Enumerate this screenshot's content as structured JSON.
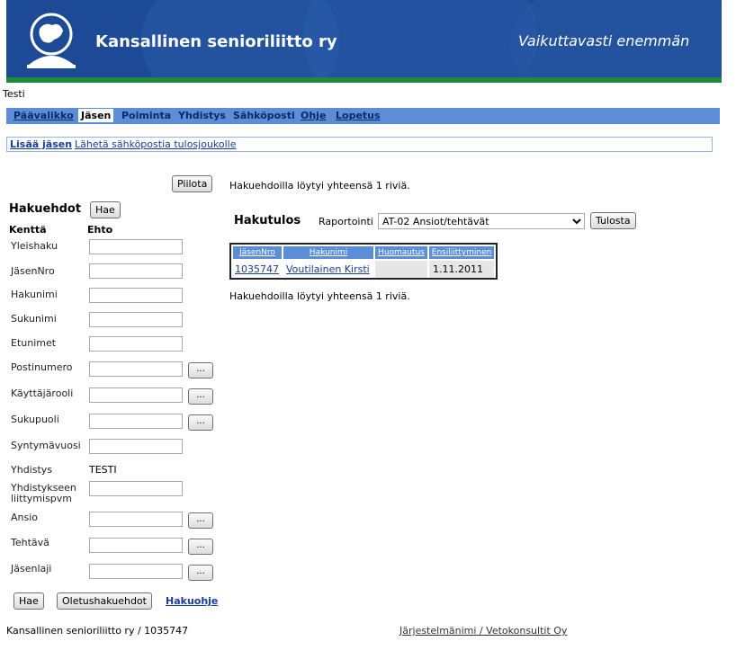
{
  "header": {
    "org_title": "Kansallinen senioriliitto ry",
    "slogan": "Vaikuttavasti enemmän",
    "colors": {
      "banner": "#1c4a96",
      "stripe": "#1e8a3a",
      "nav": "#5b8ed6"
    },
    "logo_icon": "lion-shield-icon"
  },
  "user_label": "Testi",
  "nav": {
    "items": [
      "Päävalikko",
      "Jäsen",
      "Poiminta",
      "Yhdistys",
      "Sähköposti",
      "Ohje",
      "Lopetus"
    ],
    "active": "Jäsen"
  },
  "actions": {
    "add_member": "Lisää jäsen",
    "send_email": "Lähetä sähköpostia tulosjoukolle"
  },
  "search": {
    "hide_button": "Piilota",
    "title": "Hakuehdot",
    "search_button": "Hae",
    "col_field": "Kenttä",
    "col_condition": "Ehto",
    "fields": [
      {
        "label": "Yleishaku",
        "value": ""
      },
      {
        "label": "JäsenNro",
        "value": ""
      },
      {
        "label": "Hakunimi",
        "value": ""
      },
      {
        "label": "Sukunimi",
        "value": ""
      },
      {
        "label": "Etunimet",
        "value": ""
      },
      {
        "label": "Postinumero",
        "value": "",
        "picker": "..."
      },
      {
        "label": "Käyttäjärooli",
        "value": "",
        "picker": "..."
      },
      {
        "label": "Sukupuoli",
        "value": "",
        "picker": "..."
      },
      {
        "label": "Syntymävuosi",
        "value": ""
      },
      {
        "label": "Yhdistys",
        "static_value": "TESTI"
      },
      {
        "label_line1": "Yhdistykseen",
        "label_line2": "liittymispvm",
        "value": ""
      },
      {
        "label": "Ansio",
        "value": "",
        "picker": "..."
      },
      {
        "label": "Tehtävä",
        "value": "",
        "picker": "..."
      },
      {
        "label": "Jäsenlaji",
        "value": "",
        "picker": "..."
      }
    ],
    "bottom_search_button": "Hae",
    "defaults_button": "Oletushakuehdot",
    "help_link": "Hakuohje"
  },
  "results": {
    "count_text": "Hakuehdoilla löytyi yhteensä 1 riviä.",
    "title": "Hakutulos",
    "report_label": "Raportointi",
    "report_selected": "AT-02 Ansiot/tehtävät",
    "print_button": "Tulosta",
    "columns": [
      "JäsenNro",
      "Hakunimi",
      "Huomautus",
      "Ensiliittyminen"
    ],
    "rows": [
      {
        "jasennro": "1035747",
        "hakunimi": "Voutilainen Kirsti",
        "huomautus": "",
        "ensiliittyminen": "1.11.2011"
      }
    ]
  },
  "footer": {
    "left": "Kansallinen senioriliitto ry / 1035747",
    "right": "Järjestelmänimi / Vetokonsultit Oy"
  }
}
